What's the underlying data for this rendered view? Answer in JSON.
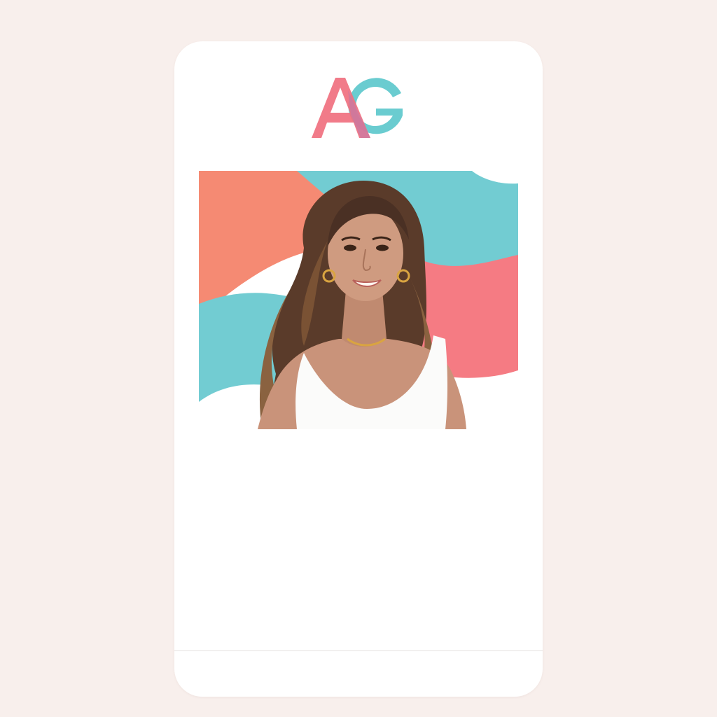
{
  "brand": {
    "logo_text": "AG",
    "logo_icon": "ag-monogram-logo",
    "colors": {
      "coral": "#f0707f",
      "teal": "#62c9ce",
      "overlap": "#c57aa6"
    }
  },
  "profile_photo": {
    "icon": "profile-portrait",
    "background_colors": {
      "salmon": "#f58a73",
      "teal": "#72ccd2",
      "pink": "#f57b83",
      "white": "#ffffff"
    }
  },
  "colors": {
    "page_background": "#f8efec",
    "card_background": "#ffffff",
    "divider": "#e6e2e1"
  }
}
